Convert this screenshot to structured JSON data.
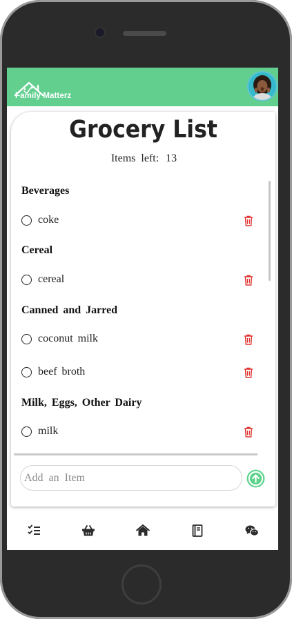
{
  "app": {
    "brand": "Family Matterz",
    "logo_icon": "house-logo-icon",
    "avatar_icon": "user-avatar",
    "colors": {
      "header": "#62cf8f",
      "accent": "#5cd38a",
      "delete": "#e0322e"
    }
  },
  "page": {
    "title": "Grocery List",
    "items_left_label": "Items left:",
    "items_left_count": "13"
  },
  "categories": [
    {
      "name": "Beverages",
      "items": [
        {
          "label": "coke",
          "checked": false
        }
      ]
    },
    {
      "name": "Cereal",
      "items": [
        {
          "label": "cereal",
          "checked": false
        }
      ]
    },
    {
      "name": "Canned and Jarred",
      "items": [
        {
          "label": "coconut milk",
          "checked": false
        },
        {
          "label": "beef broth",
          "checked": false
        }
      ]
    },
    {
      "name": "Milk, Eggs, Other Dairy",
      "items": [
        {
          "label": "milk",
          "checked": false
        }
      ]
    }
  ],
  "add_item": {
    "placeholder": "Add an Item",
    "value": "",
    "submit_icon": "arrow-up-circle-icon"
  },
  "nav": [
    {
      "name": "checklist",
      "icon": "checklist-icon"
    },
    {
      "name": "basket",
      "icon": "basket-icon"
    },
    {
      "name": "home",
      "icon": "home-icon"
    },
    {
      "name": "notebook",
      "icon": "notebook-icon"
    },
    {
      "name": "chat",
      "icon": "wechat-icon"
    }
  ]
}
